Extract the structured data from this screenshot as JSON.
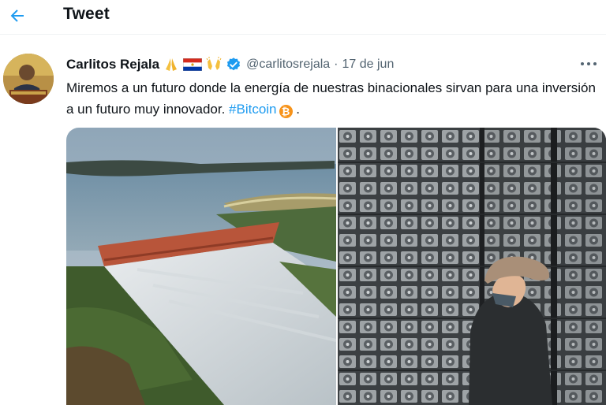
{
  "header": {
    "title": "Tweet"
  },
  "tweet": {
    "author_name": "Carlitos Rejala",
    "author_emojis": [
      "praying-hands-emoji",
      "paraguay-flag-emoji",
      "raising-hands-emoji"
    ],
    "verified": true,
    "handle": "@carlitosrejala",
    "separator": "·",
    "date": "17 de jun",
    "text_before": "Miremos a un futuro donde la energía de nuestras binacionales sirvan para una inversión a un futuro muy innovador. ",
    "hashtag": "#Bitcoin",
    "text_after": " .",
    "more_label": "···"
  },
  "media": [
    {
      "name": "hydroelectric-dam-photo"
    },
    {
      "name": "bitcoin-mining-farm-photo"
    }
  ],
  "colors": {
    "accent": "#1d9bf0",
    "text": "#0f1419",
    "muted": "#536471",
    "bitcoin": "#f7931a"
  }
}
